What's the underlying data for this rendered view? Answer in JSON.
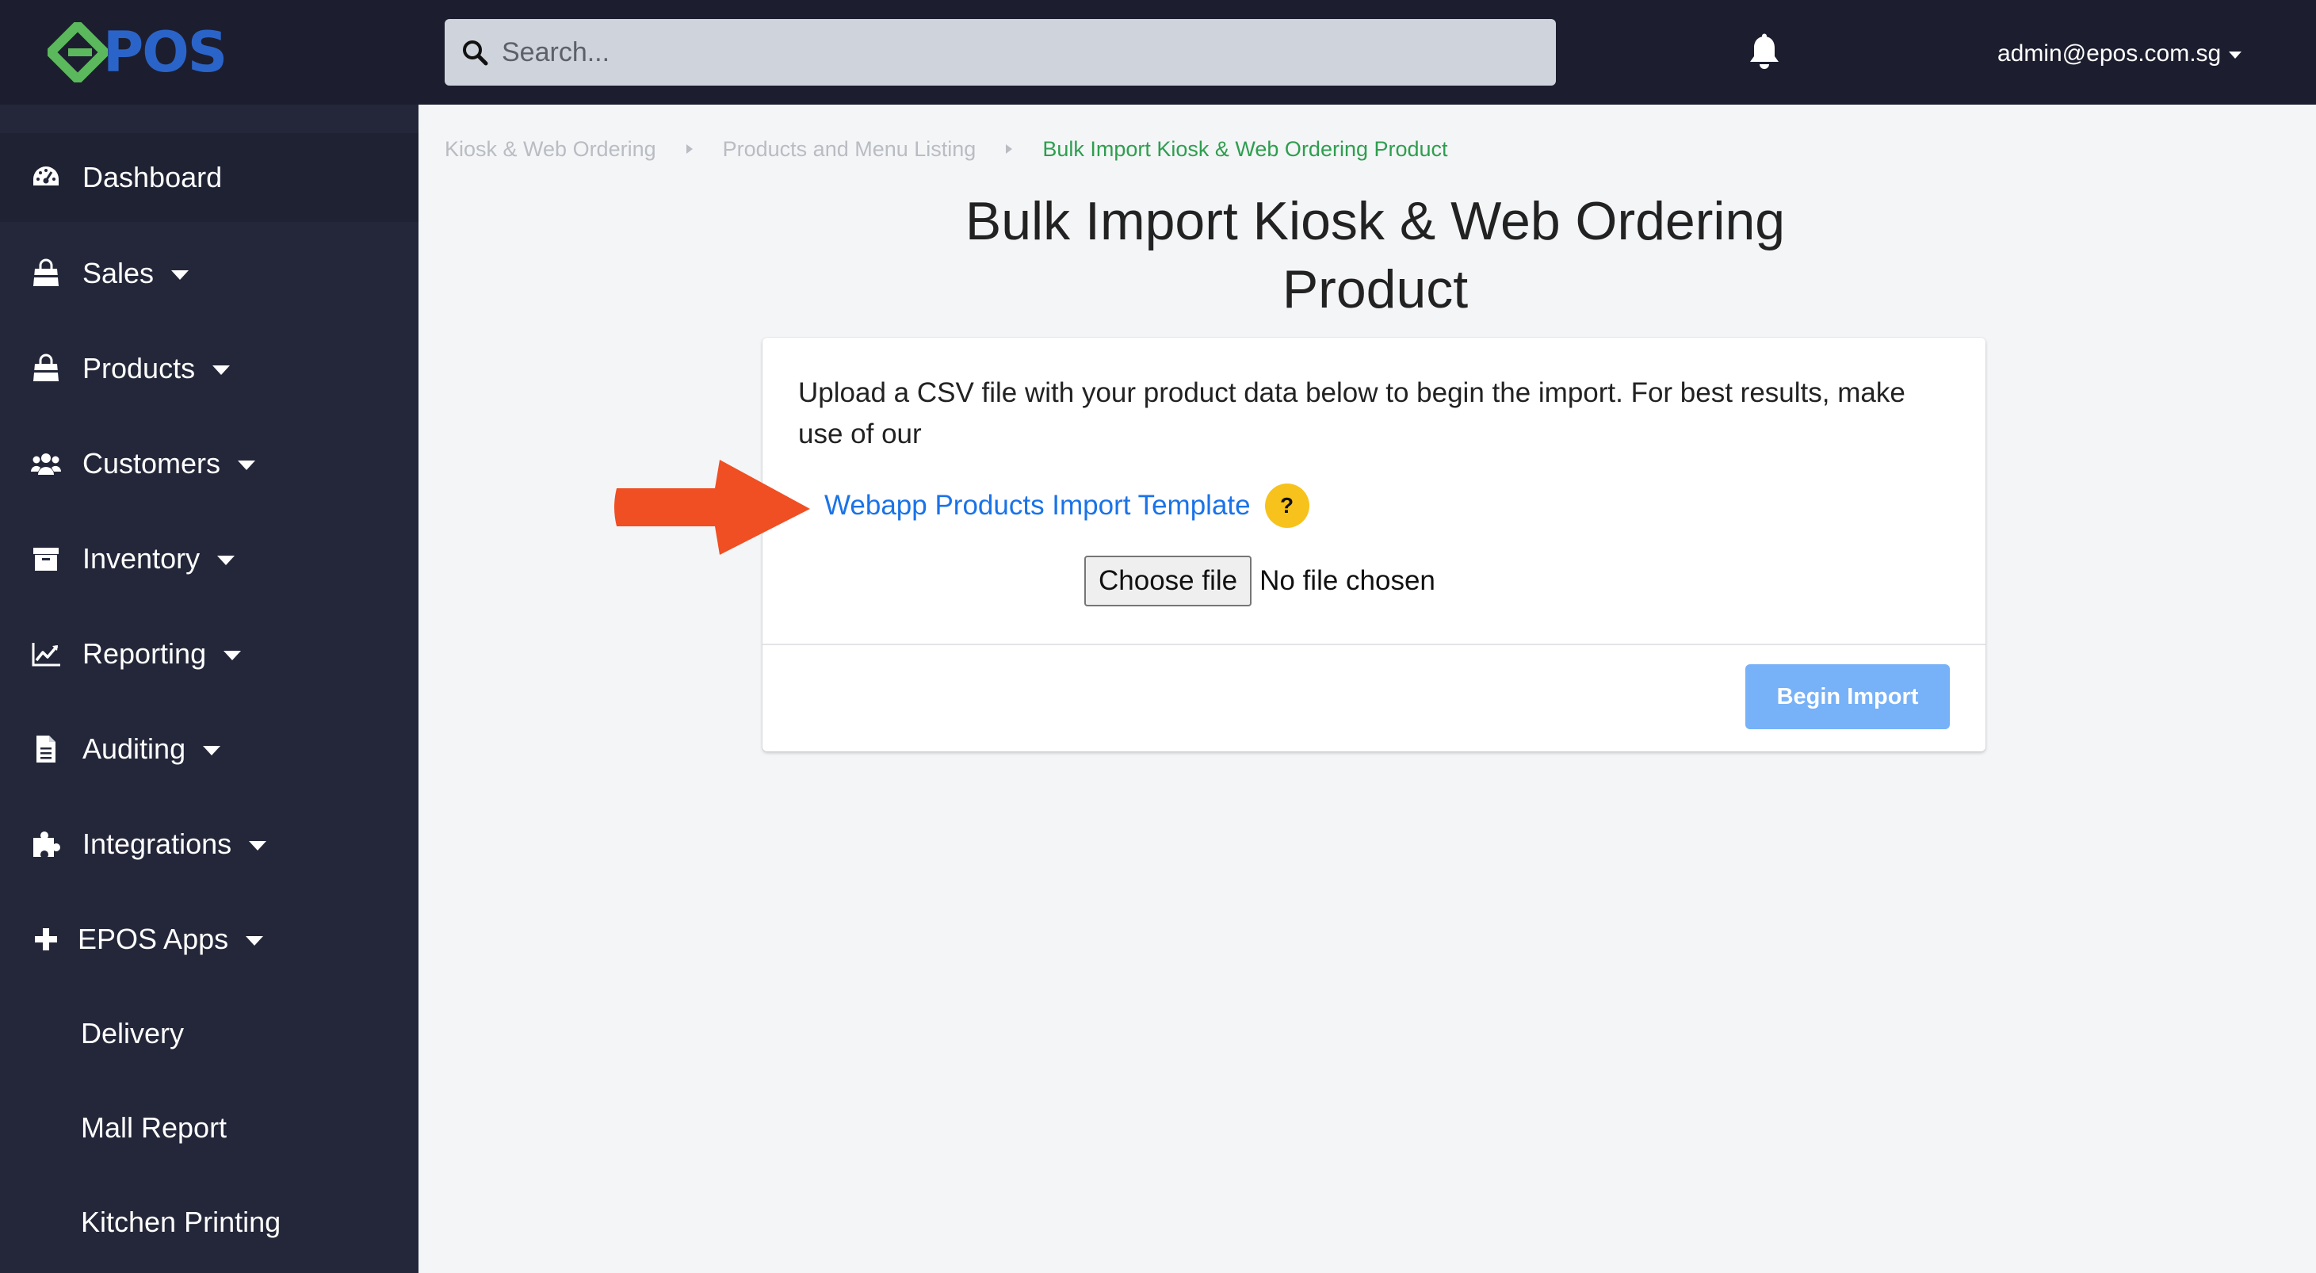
{
  "brand": {
    "logo_text": "POS",
    "logo_color": "#2b64c9",
    "mark_color": "#5cb85c"
  },
  "header": {
    "search_placeholder": "Search...",
    "notification_icon": "bell-icon",
    "user_email": "admin@epos.com.sg"
  },
  "sidebar": {
    "items": [
      {
        "label": "Dashboard",
        "icon": "dashboard-icon",
        "has_caret": false
      },
      {
        "label": "Sales",
        "icon": "shopping-bag-icon",
        "has_caret": true
      },
      {
        "label": "Products",
        "icon": "shopping-bag-icon",
        "has_caret": true
      },
      {
        "label": "Customers",
        "icon": "users-icon",
        "has_caret": true
      },
      {
        "label": "Inventory",
        "icon": "archive-icon",
        "has_caret": true
      },
      {
        "label": "Reporting",
        "icon": "chart-line-icon",
        "has_caret": true
      },
      {
        "label": "Auditing",
        "icon": "file-icon",
        "has_caret": true
      },
      {
        "label": "Integrations",
        "icon": "puzzle-icon",
        "has_caret": true
      },
      {
        "label": "EPOS Apps",
        "icon": "plus-icon",
        "has_caret": true
      },
      {
        "label": "Delivery"
      },
      {
        "label": "Mall Report"
      },
      {
        "label": "Kitchen Printing"
      }
    ]
  },
  "breadcrumb": [
    {
      "label": "Kiosk & Web Ordering"
    },
    {
      "label": "Products and Menu Listing"
    },
    {
      "label": "Bulk Import Kiosk & Web Ordering Product"
    }
  ],
  "page": {
    "title_line1": "Bulk Import Kiosk & Web Ordering",
    "title_line2": "Product"
  },
  "import_card": {
    "instructions": "Upload a CSV file with your product data below to begin the import. For best results, make use of our",
    "template_link": "Webapp Products Import Template",
    "help_badge": "?",
    "choose_file_label": "Choose file",
    "file_status": "No file chosen",
    "begin_import_label": "Begin Import"
  },
  "colors": {
    "topbar": "#1c1e2f",
    "sidebar": "#242739",
    "link": "#1a73e8",
    "breadcrumb_current": "#2e9e4e",
    "help_badge": "#f7c21b",
    "primary_button_disabled": "#77b1f7",
    "annotation_arrow": "#f04e23"
  }
}
